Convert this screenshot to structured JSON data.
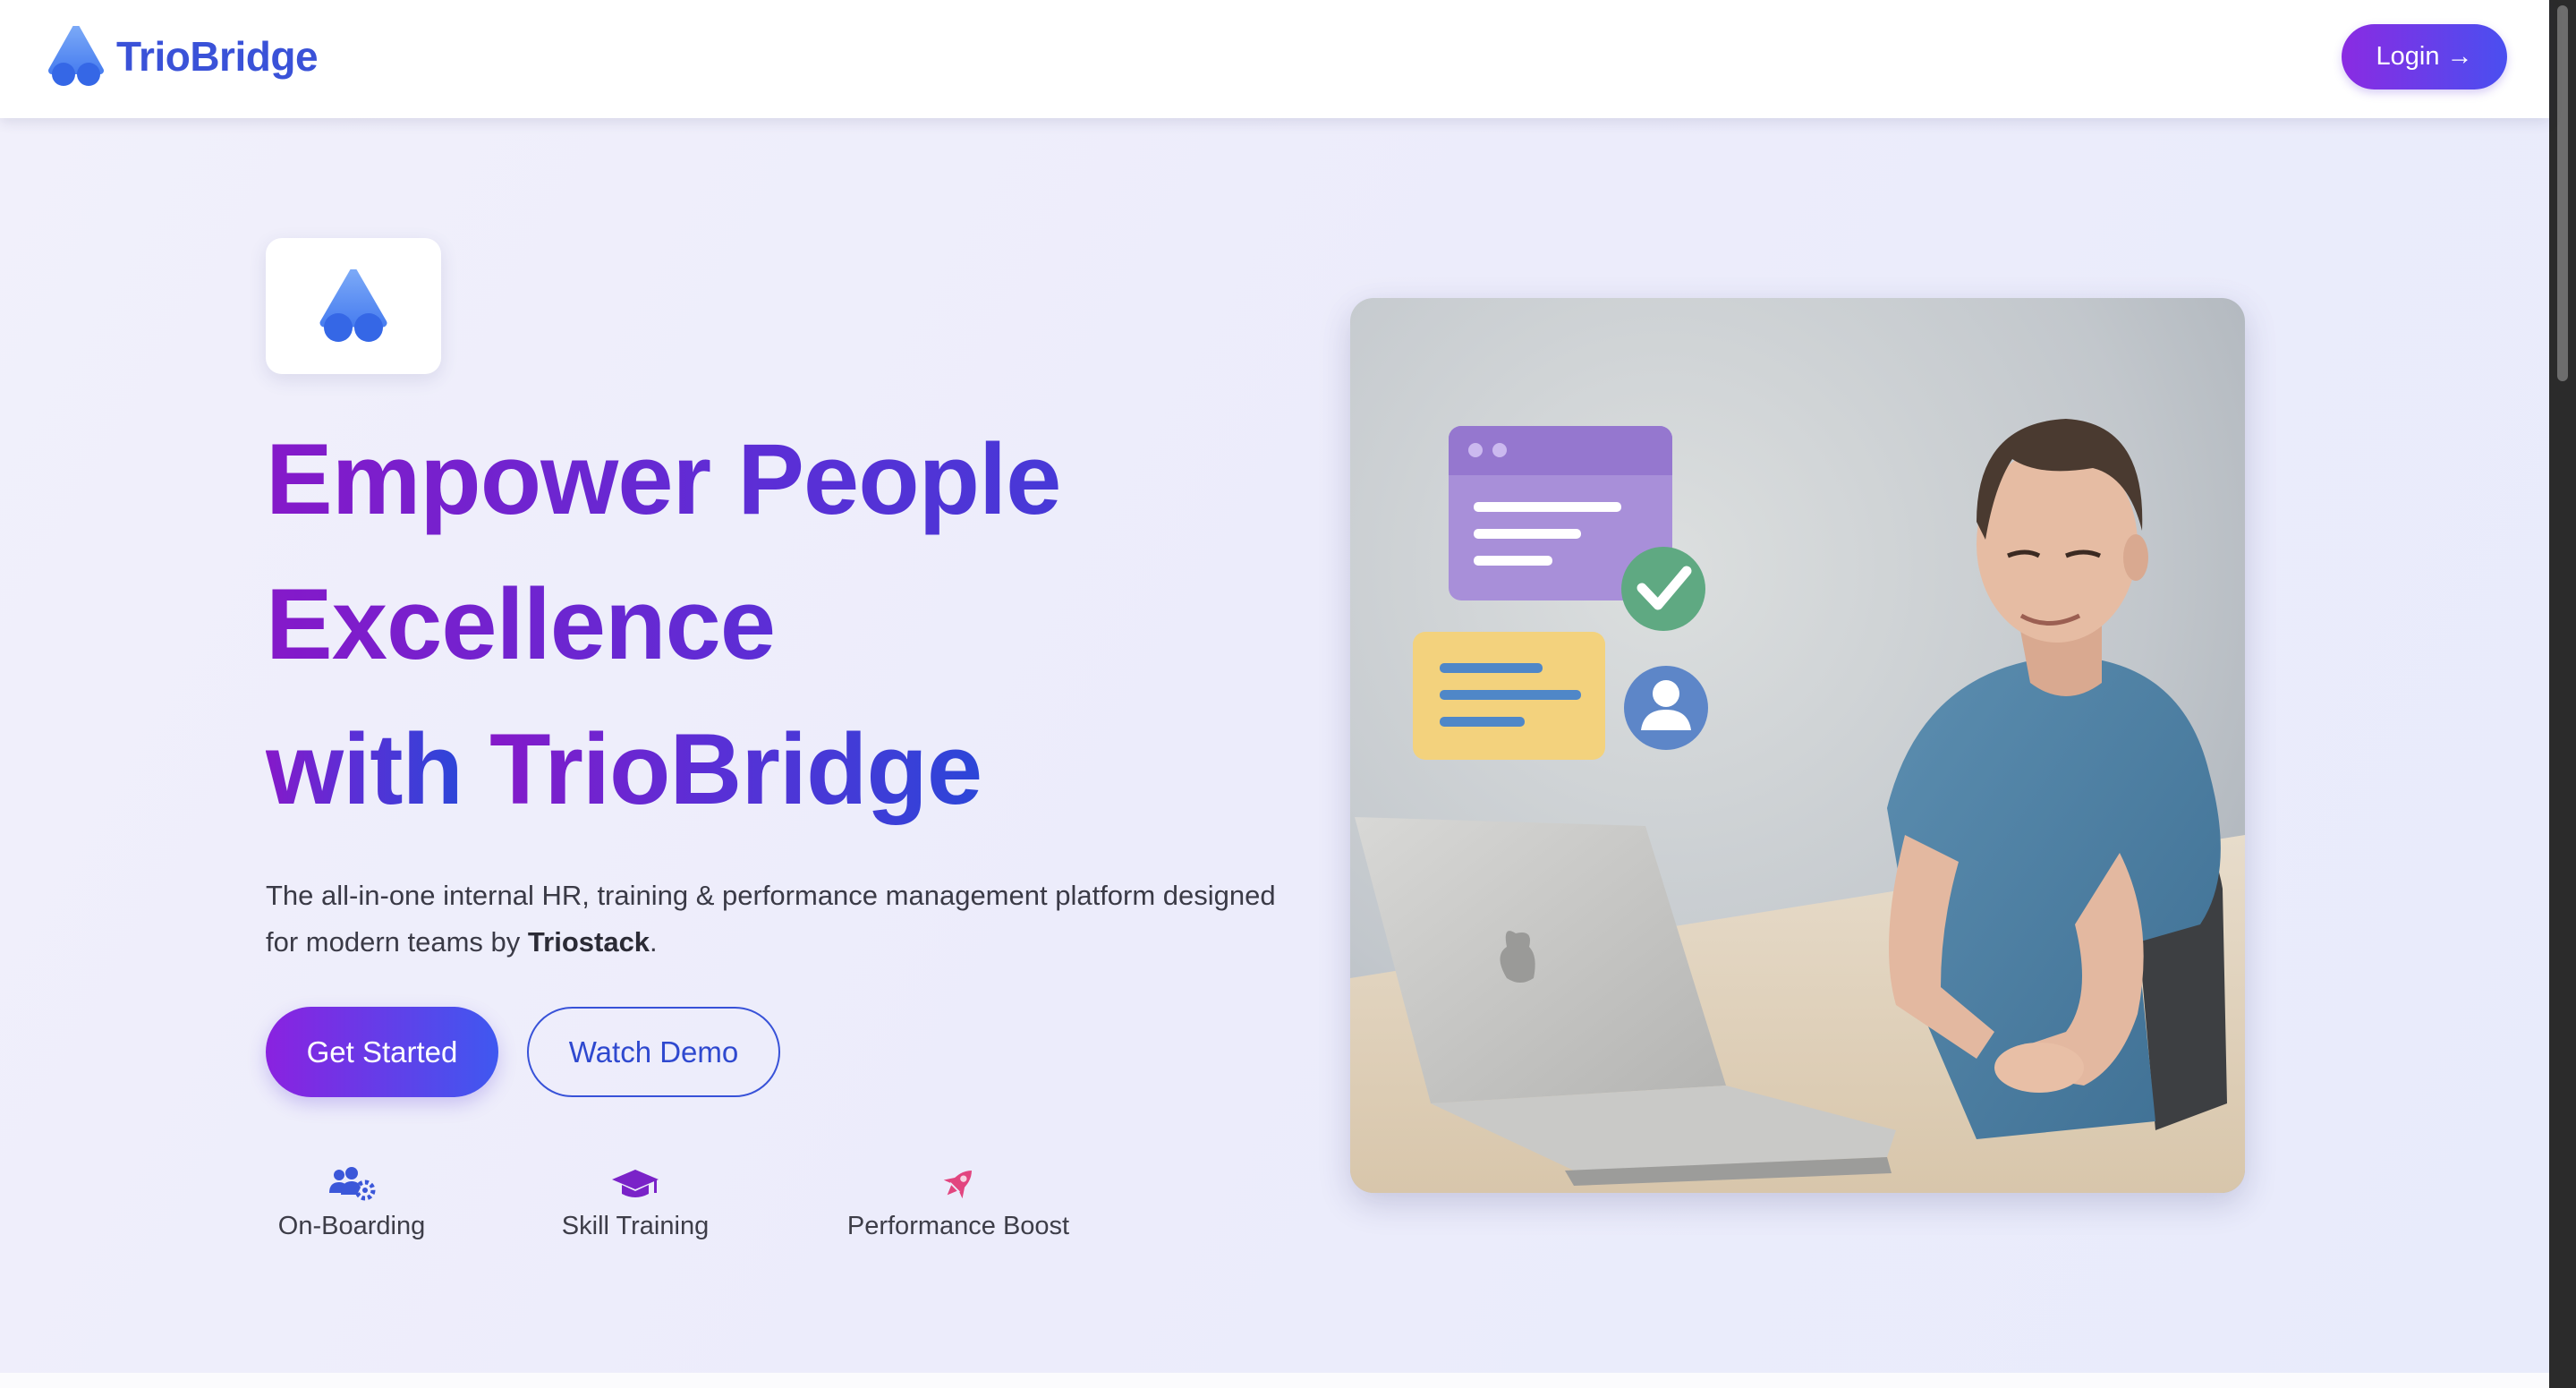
{
  "header": {
    "brand_name": "TrioBridge",
    "login_label": "Login →"
  },
  "hero": {
    "headline_line1": "Empower People",
    "headline_line2": "Excellence",
    "headline_line3_a": "with",
    "headline_line3_b": "TrioBridge",
    "subtext_main": "The all-in-one internal HR, training & performance management platform designed for modern teams by",
    "subtext_company": "Triostack",
    "subtext_end": ".",
    "primary_cta": "Get Started",
    "secondary_cta": "Watch Demo",
    "features": [
      {
        "label": "On-Boarding",
        "icon": "users-cog-icon"
      },
      {
        "label": "Skill Training",
        "icon": "graduation-cap-icon"
      },
      {
        "label": "Performance Boost",
        "icon": "rocket-icon"
      }
    ],
    "illustration": "person-at-laptop-illustration"
  },
  "colors": {
    "brand_blue": "#3a52d8",
    "brand_purple": "#8a2be2",
    "feature_icon_blue": "#3b57d9",
    "feature_icon_purple": "#7a22c8",
    "feature_icon_pink": "#e2457f"
  }
}
